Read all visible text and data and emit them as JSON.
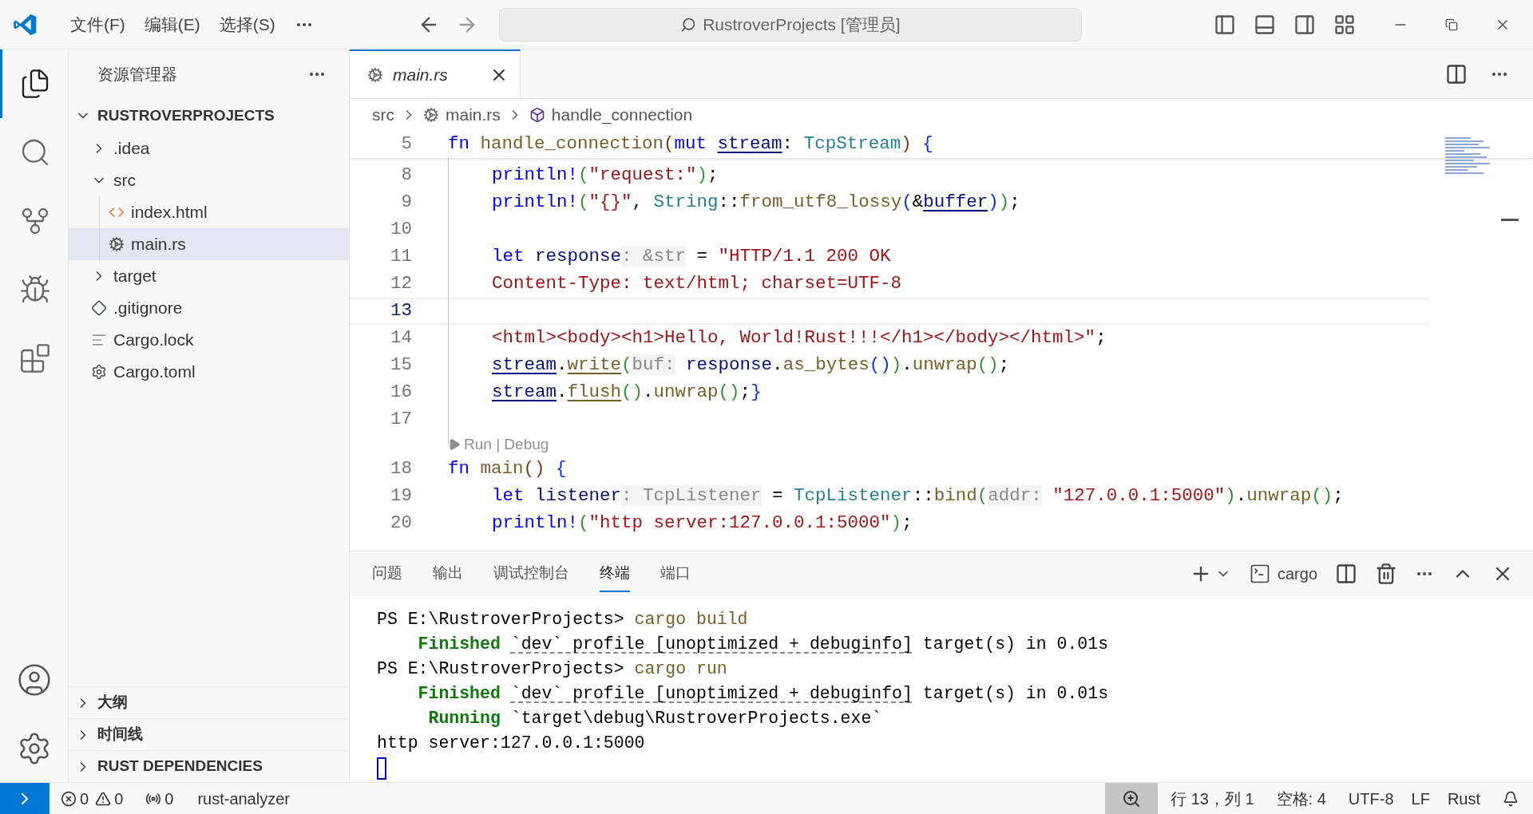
{
  "title_bar": {
    "menus": [
      "文件(F)",
      "编辑(E)",
      "选择(S)"
    ],
    "search": "RustroverProjects [管理员]"
  },
  "activity_bar": {
    "items": [
      {
        "selected": true
      },
      {
        "selected": false
      },
      {
        "selected": false
      },
      {
        "selected": false
      },
      {
        "selected": false
      }
    ]
  },
  "sidebar": {
    "title": "资源管理器",
    "section": {
      "title": "RUSTROVERPROJECTS",
      "expanded": true
    },
    "tree": [
      {
        "label": ".idea",
        "kind": "folder",
        "expanded": false,
        "selected": false
      },
      {
        "label": "src",
        "kind": "folder",
        "expanded": true,
        "selected": false,
        "children": [
          {
            "label": "index.html",
            "kind": "html",
            "selected": false
          },
          {
            "label": "main.rs",
            "kind": "rust",
            "selected": true
          }
        ]
      },
      {
        "label": "target",
        "kind": "folder",
        "expanded": false,
        "selected": false
      },
      {
        "label": ".gitignore",
        "kind": "git",
        "selected": false
      },
      {
        "label": "Cargo.lock",
        "kind": "text",
        "selected": false
      },
      {
        "label": "Cargo.toml",
        "kind": "gear",
        "selected": false
      }
    ],
    "bottom_sections": [
      {
        "title": "大纲",
        "expanded": false
      },
      {
        "title": "时间线",
        "expanded": false
      },
      {
        "title": "RUST DEPENDENCIES",
        "expanded": false
      }
    ]
  },
  "editor": {
    "tab": {
      "label": "main.rs",
      "selected": true
    },
    "breadcrumb": [
      "src",
      "main.rs",
      "handle_connection"
    ],
    "sticky": {
      "number": "5",
      "tokens": [
        {
          "kind": "kw",
          "text": "fn "
        },
        {
          "kind": "fn",
          "text": "handle_connection"
        },
        {
          "kind": "b3",
          "text": "("
        },
        {
          "kind": "kw",
          "text": "mut "
        },
        {
          "kind": "mutvar",
          "text": "stream"
        },
        {
          "kind": "plain",
          "text": ": "
        },
        {
          "kind": "type",
          "text": "TcpStream"
        },
        {
          "kind": "b3",
          "text": ") "
        },
        {
          "kind": "b1",
          "text": "{"
        }
      ]
    },
    "lines": [
      {
        "kind": "code",
        "number": "8",
        "current": false,
        "indent": true,
        "tokens": [
          {
            "kind": "kw",
            "text": "println!"
          },
          {
            "kind": "b2",
            "text": "("
          },
          {
            "kind": "str",
            "text": "\"request:\""
          },
          {
            "kind": "b2",
            "text": ")"
          },
          {
            "kind": "plain",
            "text": ";"
          }
        ]
      },
      {
        "kind": "code",
        "number": "9",
        "current": false,
        "indent": true,
        "tokens": [
          {
            "kind": "kw",
            "text": "println!"
          },
          {
            "kind": "b2",
            "text": "("
          },
          {
            "kind": "str",
            "text": "\"{}\""
          },
          {
            "kind": "plain",
            "text": ", "
          },
          {
            "kind": "type",
            "text": "String"
          },
          {
            "kind": "plain",
            "text": "::"
          },
          {
            "kind": "fn",
            "text": "from_utf8_lossy"
          },
          {
            "kind": "b1",
            "text": "("
          },
          {
            "kind": "plain",
            "text": "&"
          },
          {
            "kind": "mutvar",
            "text": "buffer"
          },
          {
            "kind": "b1",
            "text": ")"
          },
          {
            "kind": "b2",
            "text": ")"
          },
          {
            "kind": "plain",
            "text": ";"
          }
        ]
      },
      {
        "kind": "code",
        "number": "10",
        "current": false
      },
      {
        "kind": "code",
        "number": "11",
        "current": false,
        "indent": true,
        "tokens": [
          {
            "kind": "kw",
            "text": "let "
          },
          {
            "kind": "var",
            "text": "response"
          },
          {
            "kind": "hint",
            "text": ": &str"
          },
          {
            "kind": "plain",
            "text": " = "
          },
          {
            "kind": "str",
            "text": "\"HTTP/1.1 200 OK"
          }
        ]
      },
      {
        "kind": "code",
        "number": "12",
        "current": false,
        "indent": true,
        "tokens": [
          {
            "kind": "str",
            "text": "Content-Type: text/html; charset=UTF-8"
          }
        ]
      },
      {
        "kind": "code",
        "number": "13",
        "current": true
      },
      {
        "kind": "code",
        "number": "14",
        "current": false,
        "indent": true,
        "tokens": [
          {
            "kind": "str",
            "text": "<html><body><h1>Hello, World!Rust!!!</h1></body></html>\""
          },
          {
            "kind": "plain",
            "text": ";"
          }
        ]
      },
      {
        "kind": "code",
        "number": "15",
        "current": false,
        "indent": true,
        "tokens": [
          {
            "kind": "mutvar",
            "text": "stream"
          },
          {
            "kind": "plain",
            "text": "."
          },
          {
            "kind": "mutfn",
            "text": "write"
          },
          {
            "kind": "b2",
            "text": "("
          },
          {
            "kind": "hint",
            "text": "buf:"
          },
          {
            "kind": "var",
            "text": " response"
          },
          {
            "kind": "plain",
            "text": "."
          },
          {
            "kind": "fn",
            "text": "as_bytes"
          },
          {
            "kind": "b1",
            "text": "()"
          },
          {
            "kind": "b2",
            "text": ")"
          },
          {
            "kind": "plain",
            "text": "."
          },
          {
            "kind": "fn",
            "text": "unwrap"
          },
          {
            "kind": "b2",
            "text": "()"
          },
          {
            "kind": "plain",
            "text": ";"
          }
        ]
      },
      {
        "kind": "code",
        "number": "16",
        "current": false,
        "indent": true,
        "tokens": [
          {
            "kind": "mutvar",
            "text": "stream"
          },
          {
            "kind": "plain",
            "text": "."
          },
          {
            "kind": "mutfn",
            "text": "flush"
          },
          {
            "kind": "b2",
            "text": "()"
          },
          {
            "kind": "plain",
            "text": "."
          },
          {
            "kind": "fn",
            "text": "unwrap"
          },
          {
            "kind": "b2",
            "text": "()"
          },
          {
            "kind": "plain",
            "text": ";"
          },
          {
            "kind": "b1",
            "text": "}"
          }
        ]
      },
      {
        "kind": "code",
        "number": "17",
        "current": false
      },
      {
        "kind": "codelens",
        "text": "Run | Debug"
      },
      {
        "kind": "code",
        "number": "18",
        "current": false,
        "indent": false,
        "tokens": [
          {
            "kind": "kw",
            "text": "fn "
          },
          {
            "kind": "fn",
            "text": "main"
          },
          {
            "kind": "b3",
            "text": "() "
          },
          {
            "kind": "b1",
            "text": "{"
          }
        ]
      },
      {
        "kind": "code",
        "number": "19",
        "current": false,
        "indent": true,
        "tokens": [
          {
            "kind": "kw",
            "text": "let "
          },
          {
            "kind": "var",
            "text": "listener"
          },
          {
            "kind": "hint",
            "text": ": TcpListener"
          },
          {
            "kind": "plain",
            "text": " = "
          },
          {
            "kind": "type",
            "text": "TcpListener"
          },
          {
            "kind": "plain",
            "text": "::"
          },
          {
            "kind": "fn",
            "text": "bind"
          },
          {
            "kind": "b2",
            "text": "("
          },
          {
            "kind": "hint",
            "text": "addr:"
          },
          {
            "kind": "str",
            "text": " \"127.0.0.1:5000\""
          },
          {
            "kind": "b2",
            "text": ")"
          },
          {
            "kind": "plain",
            "text": "."
          },
          {
            "kind": "fn",
            "text": "unwrap"
          },
          {
            "kind": "b2",
            "text": "()"
          },
          {
            "kind": "plain",
            "text": ";"
          }
        ]
      },
      {
        "kind": "code",
        "number": "20",
        "current": false,
        "indent": true,
        "tokens": [
          {
            "kind": "kw",
            "text": "println!"
          },
          {
            "kind": "b2",
            "text": "("
          },
          {
            "kind": "str",
            "text": "\"http server:127.0.0.1:5000\""
          },
          {
            "kind": "b2",
            "text": ")"
          },
          {
            "kind": "plain",
            "text": ";"
          }
        ]
      }
    ]
  },
  "panel": {
    "tabs": [
      {
        "label": "问题",
        "selected": false
      },
      {
        "label": "输出",
        "selected": false
      },
      {
        "label": "调试控制台",
        "selected": false
      },
      {
        "label": "终端",
        "selected": true
      },
      {
        "label": "端口",
        "selected": false
      }
    ],
    "terminal_name": "cargo",
    "lines": [
      [
        {
          "kind": "plain",
          "text": "PS E:\\RustroverProjects> "
        },
        {
          "kind": "cmd",
          "text": "cargo build"
        }
      ],
      [
        {
          "kind": "status",
          "text": "    Finished "
        },
        {
          "kind": "link",
          "text": "`dev` profile [unoptimized + debuginfo]"
        },
        {
          "kind": "plain",
          "text": " target(s) in 0.01s"
        }
      ],
      [
        {
          "kind": "plain",
          "text": "PS E:\\RustroverProjects> "
        },
        {
          "kind": "cmd",
          "text": "cargo run"
        }
      ],
      [
        {
          "kind": "status",
          "text": "    Finished "
        },
        {
          "kind": "link",
          "text": "`dev` profile [unoptimized + debuginfo]"
        },
        {
          "kind": "plain",
          "text": " target(s) in 0.01s"
        }
      ],
      [
        {
          "kind": "status",
          "text": "     Running "
        },
        {
          "kind": "plain",
          "text": "`target\\debug\\RustroverProjects.exe`"
        }
      ],
      [
        {
          "kind": "plain",
          "text": "http server:127.0.0.1:5000"
        }
      ]
    ]
  },
  "status_bar": {
    "errors": "0",
    "warnings": "0",
    "ports": "0",
    "server": "rust-analyzer",
    "position": "行 13，列 1",
    "indent": "空格: 4",
    "encoding": "UTF-8",
    "eol": "LF",
    "language": "Rust"
  }
}
